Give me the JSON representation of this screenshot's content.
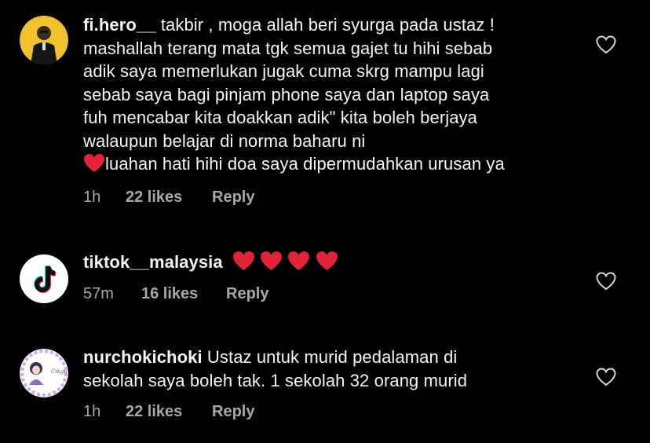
{
  "comments": [
    {
      "username": "fi.hero__",
      "first_line": "takbir , moga allah beri syurga pada ustaz !",
      "lines": [
        "mashallah terang mata tgk semua gajet tu hihi sebab",
        "adik saya memerlukan jugak cuma skrg mampu lagi",
        "sebab saya bagi pinjam phone saya dan laptop saya",
        "fuh mencabar kita doakkan adik\" kita boleh berjaya",
        "walaupun belajar di norma baharu ni"
      ],
      "last_line": "luahan hati hihi doa saya dipermudahkan urusan ya",
      "time": "1h",
      "likes": "22 likes",
      "reply": "Reply"
    },
    {
      "username": "tiktok__malaysia",
      "time": "57m",
      "likes": "16 likes",
      "reply": "Reply"
    },
    {
      "username": "nurchokichoki",
      "first_line": "Ustaz untuk murid pedalaman di",
      "lines": [
        "sekolah saya boleh tak. 1 sekolah  32 orang murid"
      ],
      "time": "1h",
      "likes": "22 likes",
      "reply": "Reply",
      "avatar_text": "Cikgu Nita"
    }
  ],
  "colors": {
    "background": "#000000",
    "text": "#f5f5f5",
    "meta": "#a8a8a8",
    "heart_red": "#e0243a"
  },
  "icons": {
    "like": "heart-outline-icon",
    "emoji": "red-heart-emoji"
  }
}
